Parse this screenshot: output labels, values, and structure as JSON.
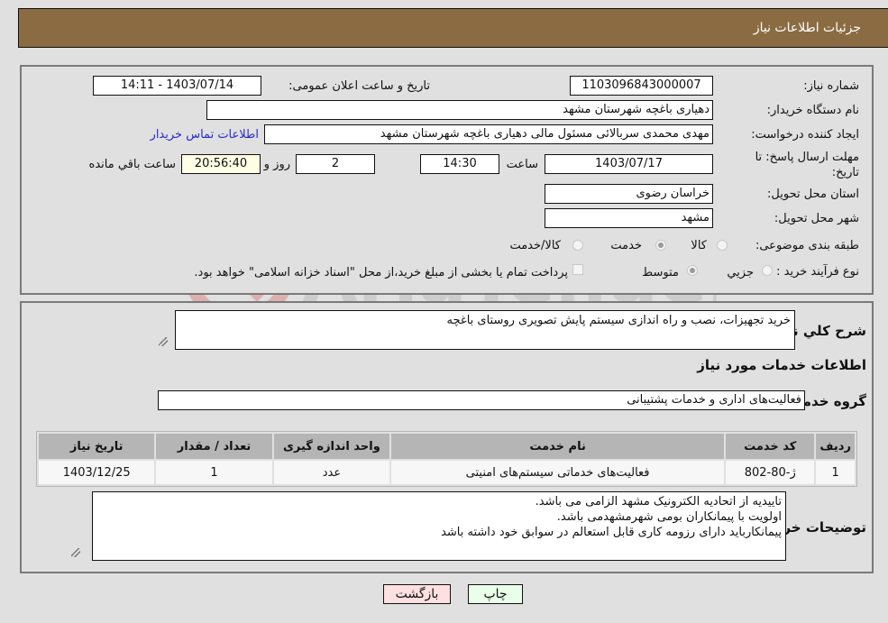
{
  "header": {
    "title": "جزئیات اطلاعات نیاز"
  },
  "form": {
    "need_number": {
      "label": "شماره نیاز:",
      "value": "1103096843000007"
    },
    "announce_datetime": {
      "label": "تاریخ و ساعت اعلان عمومی:",
      "value": "1403/07/14 - 14:11"
    },
    "buyer_org": {
      "label": "نام دستگاه خریدار:",
      "value": "دهیاری باغچه  شهرستان مشهد"
    },
    "requester": {
      "label": "ایجاد کننده درخواست:",
      "value": "مهدی محمدی سربالائی مسئول مالی دهیاری باغچه  شهرستان مشهد"
    },
    "contact_link": "اطلاعات تماس خریدار",
    "deadline": {
      "label": "مهلت ارسال پاسخ: تا تاریخ:",
      "date": "1403/07/17",
      "time_label": "ساعت",
      "time": "14:30",
      "days": "2",
      "days_label": "روز و",
      "remaining": "20:56:40",
      "remaining_label": "ساعت باقي مانده"
    },
    "province": {
      "label": "استان محل تحویل:",
      "value": "خراسان رضوی"
    },
    "city": {
      "label": "شهر محل تحویل:",
      "value": "مشهد"
    },
    "category": {
      "label": "طبقه بندی موضوعی:",
      "options": [
        "کالا",
        "خدمت",
        "کالا/خدمت"
      ],
      "selected": "خدمت"
    },
    "process": {
      "label": "نوع فرآیند خرید :",
      "options": [
        "جزيي",
        "متوسط"
      ],
      "selected": "متوسط",
      "treasury_note": "پرداخت تمام یا بخشی از مبلغ خرید،از محل \"اسناد خزانه اسلامی\" خواهد بود.",
      "treasury_checked": false
    }
  },
  "details": {
    "description_label": "شرح کلي نیاز:",
    "description": "خرید تجهیزات، نصب و راه اندازی سیستم پایش تصویری روستای باغچه",
    "services_heading": "اطلاعات خدمات مورد نیاز",
    "service_group_label": "گروه خدمت:",
    "service_group": "فعالیت‌های اداری و خدمات پشتیبانی",
    "table": {
      "headers": [
        "ردیف",
        "کد خدمت",
        "نام خدمت",
        "واحد اندازه گیری",
        "تعداد / مقدار",
        "تاریخ نیاز"
      ],
      "rows": [
        [
          "1",
          "ژ-80-802",
          "فعالیت‌های خدماتی سیستم‌های امنیتی",
          "عدد",
          "1",
          "1403/12/25"
        ]
      ]
    },
    "buyer_notes_label": "توضیحات خریدار:",
    "buyer_notes": "تاییدیه از اتحادیه الکترونیک مشهد الزامی می باشد.\nاولویت با پیمانکاران بومی شهرمشهدمی باشد.\nپیمانکارباید دارای رزومه کاری قابل استعالم در سوابق خود داشته باشد"
  },
  "buttons": {
    "print": "چاپ",
    "back": "بازگشت"
  },
  "colors": {
    "header_bg": "#8b6c42",
    "print_bg": "#eaffea",
    "back_bg": "#ffe0e0",
    "link": "#2929c9"
  },
  "watermark": "AriaTender.neT"
}
